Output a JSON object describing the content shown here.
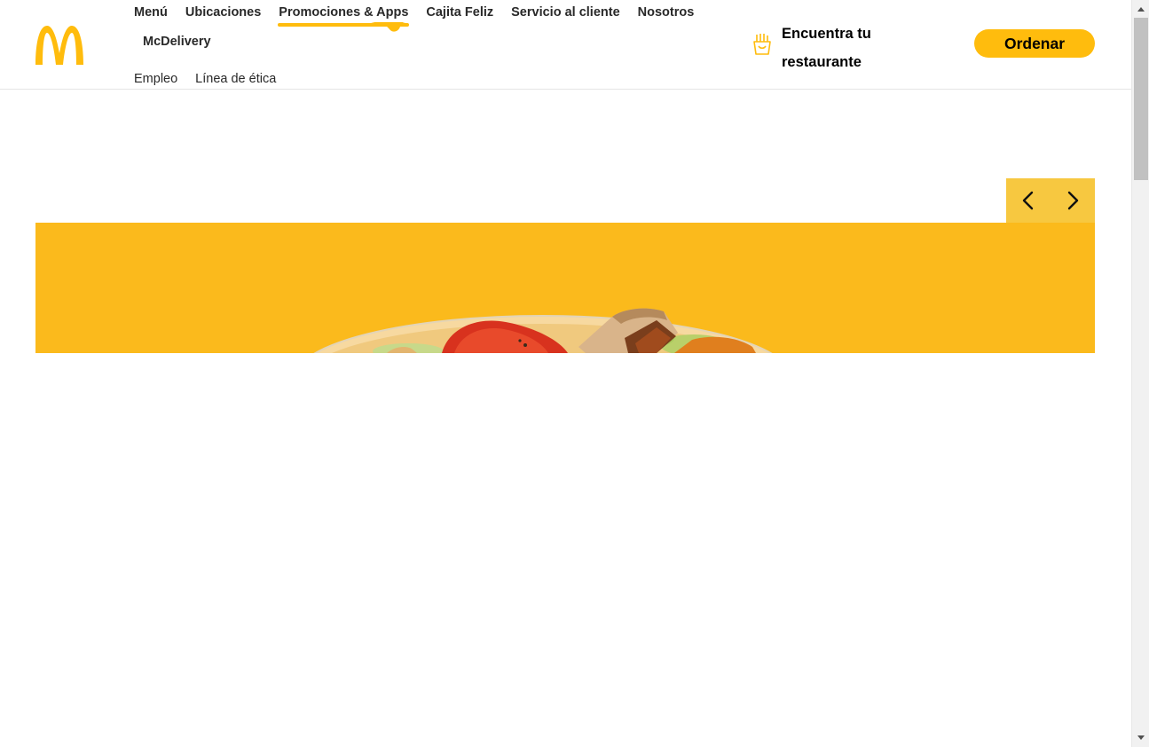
{
  "header": {
    "nav_primary": [
      {
        "label": "Menú"
      },
      {
        "label": "Ubicaciones"
      },
      {
        "label": "Promociones & Apps",
        "active": true
      },
      {
        "label": "Cajita Feliz"
      },
      {
        "label": "Servicio al cliente"
      },
      {
        "label": "Nosotros"
      }
    ],
    "nav_primary_row2": [
      {
        "label": "McDelivery"
      }
    ],
    "nav_secondary": [
      {
        "label": "Empleo"
      },
      {
        "label": "Línea de ética"
      }
    ],
    "find_restaurant_label": "Encuentra tu restaurante",
    "order_label": "Ordenar"
  },
  "icons": {
    "logo": "golden-arches-logo",
    "find": "fries-icon",
    "prev": "chevron-left-icon",
    "next": "chevron-right-icon"
  },
  "colors": {
    "brand_yellow": "#ffbc0d",
    "banner_yellow": "#fbba1c",
    "carousel_control": "#f7c840",
    "text": "#292929"
  }
}
